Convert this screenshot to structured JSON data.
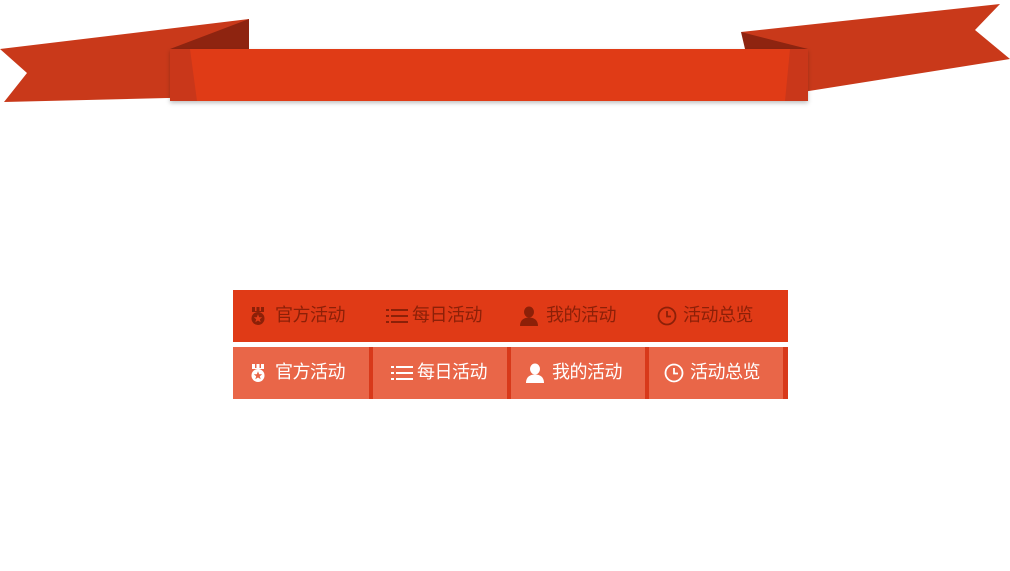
{
  "colors": {
    "ribbon_main": "#e03a16",
    "ribbon_tail": "#c9391a",
    "ribbon_fold": "#8e2410",
    "tab_normal_bg": "#e03a16",
    "tab_normal_text": "#8c2008",
    "tab_hover_bg": "#e96648",
    "tab_hover_text": "#ffffff"
  },
  "nav_normal": {
    "tabs": [
      {
        "label": "官方活动",
        "icon": "medal-icon"
      },
      {
        "label": "每日活动",
        "icon": "list-icon"
      },
      {
        "label": "我的活动",
        "icon": "user-icon"
      },
      {
        "label": "活动总览",
        "icon": "clock-icon"
      }
    ]
  },
  "nav_hover": {
    "tabs": [
      {
        "label": "官方活动",
        "icon": "medal-icon"
      },
      {
        "label": "每日活动",
        "icon": "list-icon"
      },
      {
        "label": "我的活动",
        "icon": "user-icon"
      },
      {
        "label": "活动总览",
        "icon": "clock-icon"
      }
    ]
  }
}
